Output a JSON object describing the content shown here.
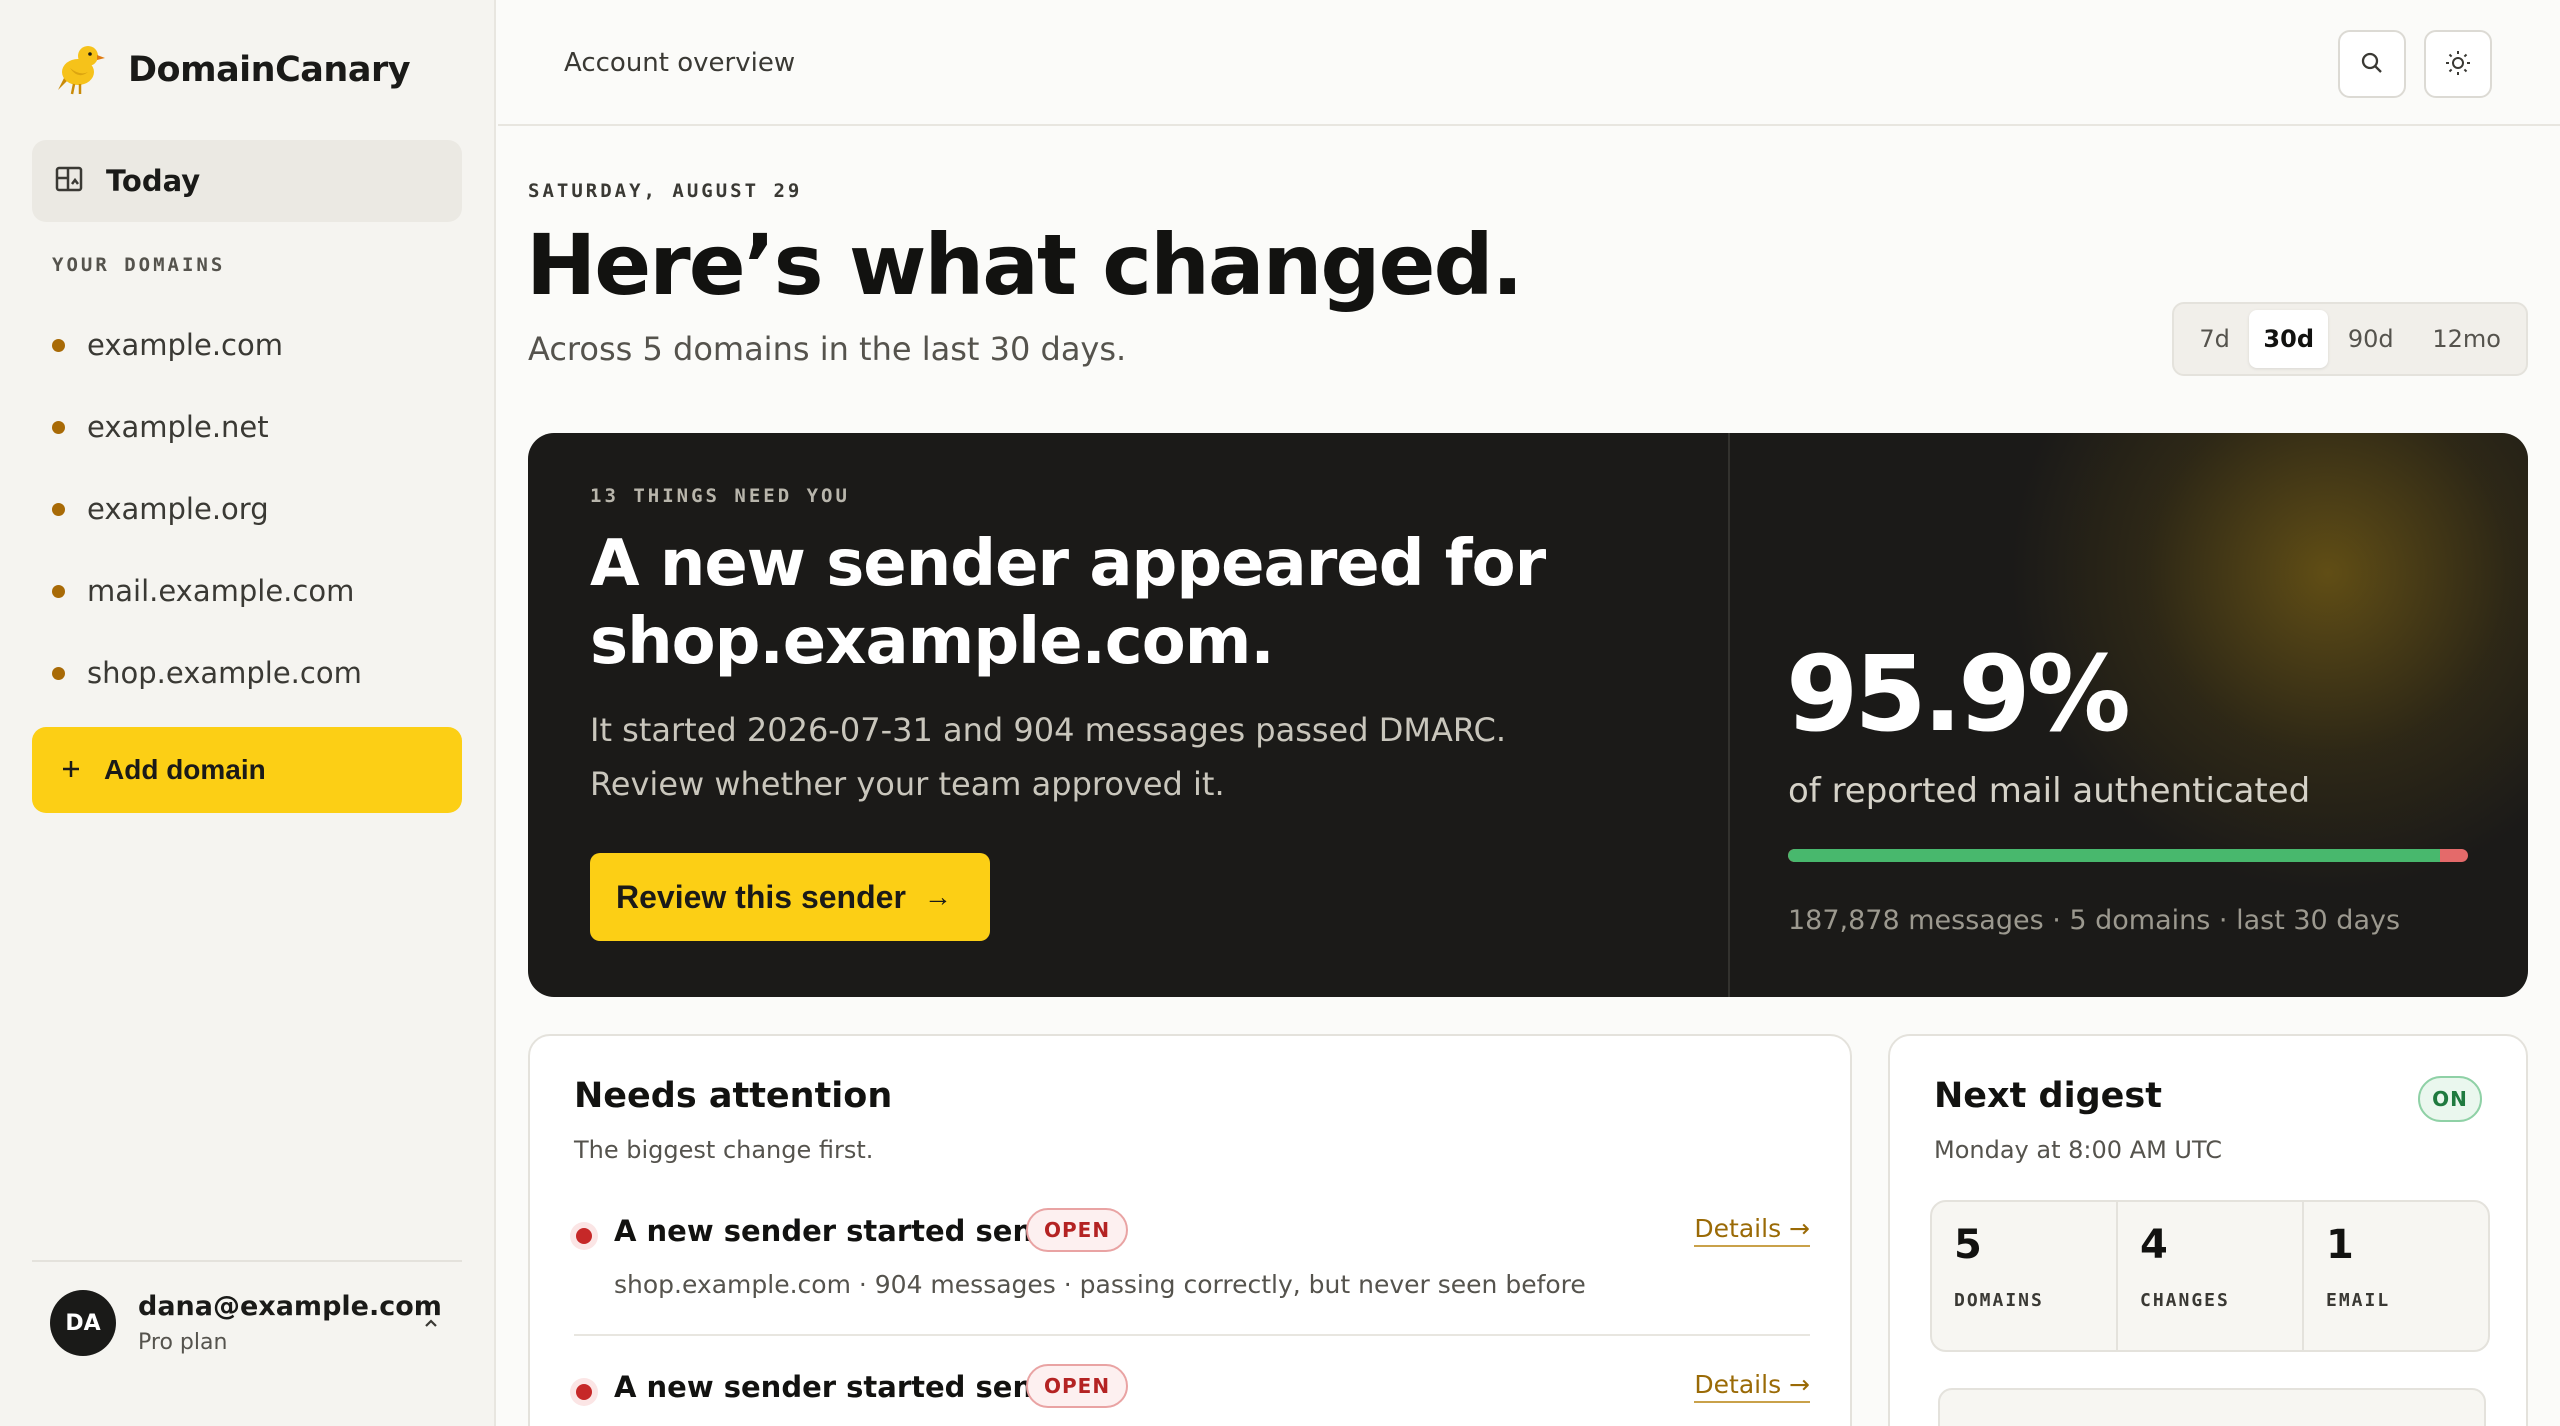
{
  "app": {
    "name": "DomainCanary",
    "logo_icon": "canary-bird-icon"
  },
  "sidebar": {
    "today_label": "Today",
    "section_label": "YOUR DOMAINS",
    "domains": [
      "example.com",
      "example.net",
      "example.org",
      "mail.example.com",
      "shop.example.com"
    ],
    "add_domain_label": "Add domain",
    "user": {
      "initials": "DA",
      "email": "dana@example.com",
      "plan": "Pro plan"
    }
  },
  "header": {
    "breadcrumb": "Account overview"
  },
  "overview": {
    "date_label": "SATURDAY, AUGUST 29",
    "title": "Here’s what changed.",
    "subtitle": "Across 5 domains in the last 30 days.",
    "ranges": [
      {
        "label": "7d",
        "active": false
      },
      {
        "label": "30d",
        "active": true
      },
      {
        "label": "90d",
        "active": false
      },
      {
        "label": "12mo",
        "active": false
      }
    ]
  },
  "hero": {
    "kicker": "13 THINGS NEED YOU",
    "title": "A new sender appeared for shop.example.com.",
    "body": "It started 2026-07-31 and 904 messages passed DMARC. Review whether your team approved it.",
    "cta_label": "Review this sender",
    "cta_arrow": "→",
    "stat_value": "95.9%",
    "stat_label": "of reported mail authenticated",
    "auth_fraction": 0.959,
    "meta": "187,878 messages · 5 domains · last 30 days"
  },
  "attention": {
    "title": "Needs attention",
    "subtitle": "The biggest change first.",
    "items": [
      {
        "title": "A new sender started sending",
        "badge": "OPEN",
        "desc": "shop.example.com · 904 messages · passing correctly, but never seen before",
        "link": "Details →"
      },
      {
        "title": "A new sender started sending",
        "badge": "OPEN",
        "desc": "",
        "link": "Details →"
      }
    ]
  },
  "digest": {
    "title": "Next digest",
    "schedule": "Monday at 8:00 AM UTC",
    "status": "ON",
    "stats": [
      {
        "value": "5",
        "label": "DOMAINS"
      },
      {
        "value": "4",
        "label": "CHANGES"
      },
      {
        "value": "1",
        "label": "EMAIL"
      }
    ]
  },
  "colors": {
    "accent": "#fccf15",
    "dark_card": "#1b1a18",
    "pass": "#48b86d",
    "fail": "#e46a6a",
    "danger": "#c62828"
  }
}
